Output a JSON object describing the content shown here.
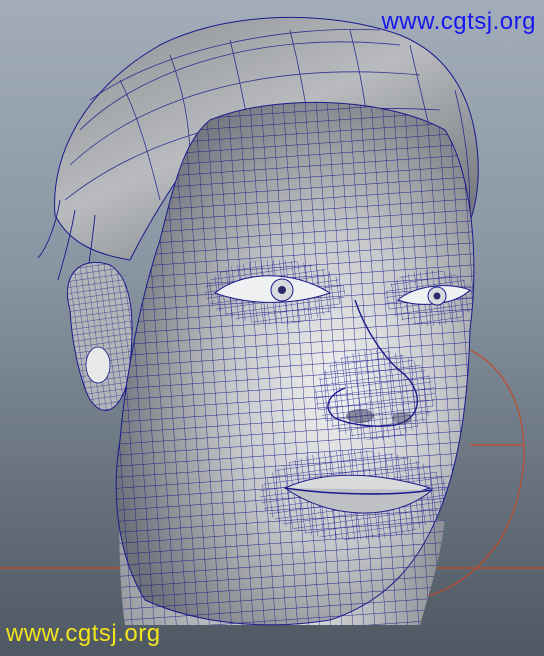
{
  "watermarks": {
    "top_right": "www.cgtsj.org",
    "bottom_left": "www.cgtsj.org"
  },
  "viewport": {
    "subject": "3d-head-wireframe-model",
    "colors": {
      "background_top": "#a2adb9",
      "background_bottom": "#4f5862",
      "mesh_fill": "#a9abad",
      "wireframe": "#1a1a8c",
      "grid_line": "#c04b2b",
      "top_watermark": "#1818ee",
      "bottom_watermark": "#f1e41e"
    }
  }
}
